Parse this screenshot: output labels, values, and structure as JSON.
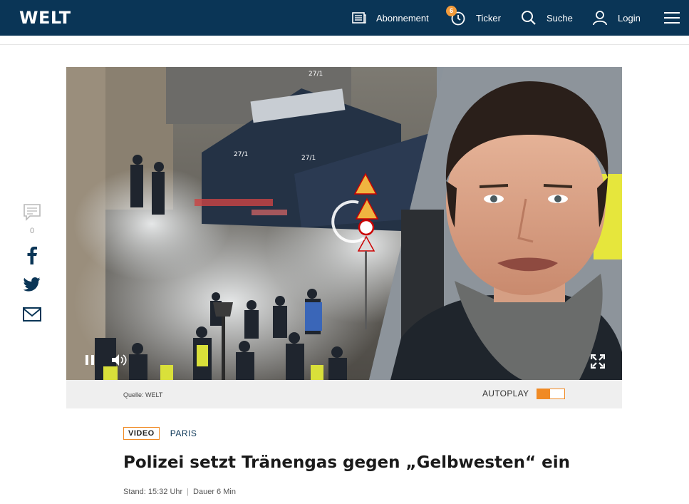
{
  "header": {
    "logo": "WELT",
    "nav": {
      "abonnement": "Abonnement",
      "ticker": "Ticker",
      "ticker_badge": "6",
      "suche": "Suche",
      "login": "Login"
    }
  },
  "social": {
    "comment_count": "0",
    "icons": [
      "comment-icon",
      "facebook-icon",
      "twitter-icon",
      "mail-icon"
    ]
  },
  "video": {
    "source": "Quelle: WELT",
    "autoplay_label": "AUTOPLAY",
    "autoplay_on": true,
    "vehicle_numbers": [
      "27/1",
      "27/1",
      "27/1"
    ]
  },
  "article": {
    "kicker_badge": "VIDEO",
    "kicker_topic": "PARIS",
    "headline": "Polizei setzt Tränengas gegen „Gelbwesten“ ein",
    "stand": "Stand: 15:32 Uhr",
    "dauer": "Dauer 6 Min"
  },
  "colors": {
    "header_bg": "#0a3556",
    "accent": "#f08a24",
    "badge": "#f29b3b"
  }
}
